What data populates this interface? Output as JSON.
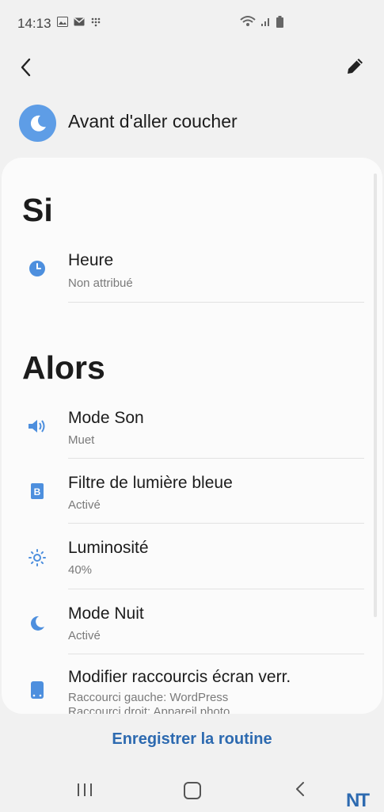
{
  "status_bar": {
    "time": "14:13",
    "icons": [
      "gallery-icon",
      "mail-icon",
      "grid-icon"
    ],
    "right_icons": [
      "wifi-icon",
      "signal-icon",
      "battery-icon"
    ]
  },
  "toolbar": {
    "back_icon": "back-arrow-icon",
    "edit_icon": "pencil-icon"
  },
  "header": {
    "icon": "moon-icon",
    "title": "Avant d'aller coucher"
  },
  "if_section": {
    "title": "Si",
    "items": [
      {
        "icon": "clock-icon",
        "title": "Heure",
        "subtitle": "Non attribué"
      }
    ]
  },
  "then_section": {
    "title": "Alors",
    "items": [
      {
        "icon": "speaker-icon",
        "title": "Mode Son",
        "subtitle": "Muet"
      },
      {
        "icon": "blue-light-filter-icon",
        "title": "Filtre de lumière bleue",
        "subtitle": "Activé"
      },
      {
        "icon": "brightness-icon",
        "title": "Luminosité",
        "subtitle": "40%"
      },
      {
        "icon": "moon-icon",
        "title": "Mode Nuit",
        "subtitle": "Activé"
      },
      {
        "icon": "phone-icon",
        "title": "Modifier raccourcis écran verr.",
        "subtitle": "Raccourci gauche: WordPress",
        "subtitle2": "Raccourci droit: Appareil photo"
      }
    ]
  },
  "footer": {
    "save_label": "Enregistrer la routine"
  },
  "watermark": "NT",
  "colors": {
    "accent": "#5e9de6",
    "link": "#2d6ab0",
    "background": "#f1f1f1",
    "card": "#fbfbfb"
  }
}
